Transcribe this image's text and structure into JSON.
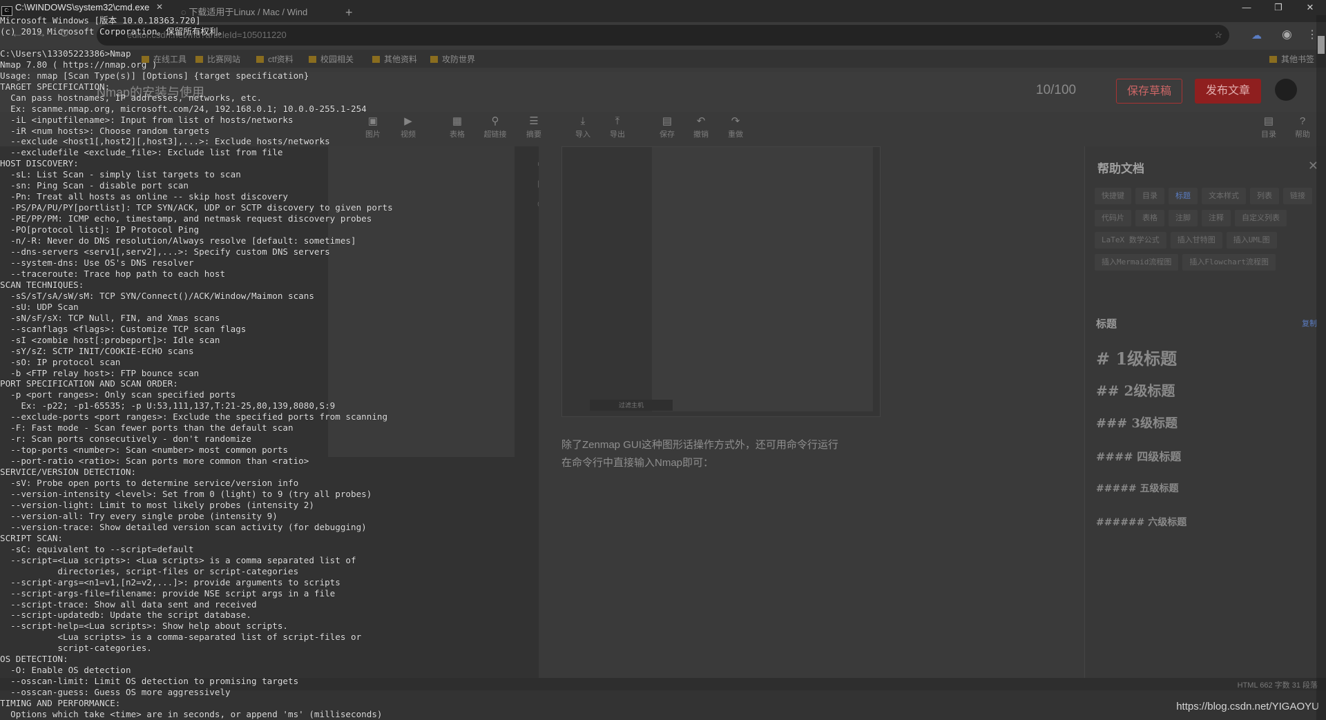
{
  "browser": {
    "tabs": [
      {
        "label": "下载适用于Linux / Mac / Wind"
      }
    ],
    "new_tab": "+",
    "address": "editor.csdn.net/md?articleId=105011220",
    "bookmarks": [
      "在线工具",
      "比赛网站",
      "ctf资料",
      "校园相关",
      "其他资料",
      "攻防世界"
    ],
    "other_bookmarks": "其他书签",
    "article_title": "Nmap的安装与使用",
    "word_count": "10/100",
    "save_draft": "保存草稿",
    "publish": "发布文章",
    "toolbar": [
      {
        "icon": "image-icon",
        "glyph": "▣",
        "label": "图片"
      },
      {
        "icon": "video-icon",
        "glyph": "▶",
        "label": "视频"
      },
      {
        "icon": "table-icon",
        "glyph": "▦",
        "label": "表格"
      },
      {
        "icon": "link-icon",
        "glyph": "⚲",
        "label": "超链接"
      },
      {
        "icon": "summary-icon",
        "glyph": "☰",
        "label": "摘要"
      },
      {
        "icon": "import-icon",
        "glyph": "⤓",
        "label": "导入"
      },
      {
        "icon": "export-icon",
        "glyph": "⤒",
        "label": "导出"
      },
      {
        "icon": "save-icon",
        "glyph": "▤",
        "label": "保存"
      },
      {
        "icon": "undo-icon",
        "glyph": "↶",
        "label": "撤销"
      },
      {
        "icon": "redo-icon",
        "glyph": "↷",
        "label": "重做"
      },
      {
        "icon": "toc-icon",
        "glyph": "▤",
        "label": "目录"
      },
      {
        "icon": "help-icon",
        "glyph": "?",
        "label": "帮助"
      }
    ],
    "image_caption": "过滤主机",
    "preview_text": "除了Zenmap GUI这种图形话操作方式外，还可用命令行运行\n在命令行中直接输入Nmap即可：",
    "help": {
      "title": "帮助文档",
      "chips": [
        "快捷键",
        "目录",
        "标题",
        "文本样式",
        "列表",
        "链接",
        "代码片",
        "表格",
        "注脚",
        "注释",
        "自定义列表",
        "LaTeX 数学公式",
        "插入甘特图",
        "插入UML图",
        "插入Mermaid流程图",
        "插入Flowchart流程图"
      ],
      "section": "标题",
      "copy": "复制",
      "headings": [
        "# 1级标题",
        "## 2级标题",
        "### 3级标题",
        "#### 四级标题",
        "##### 五级标题",
        "###### 六级标题"
      ]
    },
    "status": "HTML 662 字数 31 段落",
    "watermark": "https://blog.csdn.net/YIGAOYU"
  },
  "cmd": {
    "title": "C:\\WINDOWS\\system32\\cmd.exe",
    "controls": {
      "minimize": "—",
      "maximize": "❐",
      "close": "✕"
    },
    "output": [
      "Microsoft Windows [版本 10.0.18363.720]",
      "(c) 2019 Microsoft Corporation。保留所有权利。",
      "",
      "C:\\Users\\13305223386>Nmap",
      "Nmap 7.80 ( https://nmap.org )",
      "Usage: nmap [Scan Type(s)] [Options] {target specification}",
      "TARGET SPECIFICATION:",
      "  Can pass hostnames, IP addresses, networks, etc.",
      "  Ex: scanme.nmap.org, microsoft.com/24, 192.168.0.1; 10.0.0-255.1-254",
      "  -iL <inputfilename>: Input from list of hosts/networks",
      "  -iR <num hosts>: Choose random targets",
      "  --exclude <host1[,host2][,host3],...>: Exclude hosts/networks",
      "  --excludefile <exclude_file>: Exclude list from file",
      "HOST DISCOVERY:",
      "  -sL: List Scan - simply list targets to scan",
      "  -sn: Ping Scan - disable port scan",
      "  -Pn: Treat all hosts as online -- skip host discovery",
      "  -PS/PA/PU/PY[portlist]: TCP SYN/ACK, UDP or SCTP discovery to given ports",
      "  -PE/PP/PM: ICMP echo, timestamp, and netmask request discovery probes",
      "  -PO[protocol list]: IP Protocol Ping",
      "  -n/-R: Never do DNS resolution/Always resolve [default: sometimes]",
      "  --dns-servers <serv1[,serv2],...>: Specify custom DNS servers",
      "  --system-dns: Use OS's DNS resolver",
      "  --traceroute: Trace hop path to each host",
      "SCAN TECHNIQUES:",
      "  -sS/sT/sA/sW/sM: TCP SYN/Connect()/ACK/Window/Maimon scans",
      "  -sU: UDP Scan",
      "  -sN/sF/sX: TCP Null, FIN, and Xmas scans",
      "  --scanflags <flags>: Customize TCP scan flags",
      "  -sI <zombie host[:probeport]>: Idle scan",
      "  -sY/sZ: SCTP INIT/COOKIE-ECHO scans",
      "  -sO: IP protocol scan",
      "  -b <FTP relay host>: FTP bounce scan",
      "PORT SPECIFICATION AND SCAN ORDER:",
      "  -p <port ranges>: Only scan specified ports",
      "    Ex: -p22; -p1-65535; -p U:53,111,137,T:21-25,80,139,8080,S:9",
      "  --exclude-ports <port ranges>: Exclude the specified ports from scanning",
      "  -F: Fast mode - Scan fewer ports than the default scan",
      "  -r: Scan ports consecutively - don't randomize",
      "  --top-ports <number>: Scan <number> most common ports",
      "  --port-ratio <ratio>: Scan ports more common than <ratio>",
      "SERVICE/VERSION DETECTION:",
      "  -sV: Probe open ports to determine service/version info",
      "  --version-intensity <level>: Set from 0 (light) to 9 (try all probes)",
      "  --version-light: Limit to most likely probes (intensity 2)",
      "  --version-all: Try every single probe (intensity 9)",
      "  --version-trace: Show detailed version scan activity (for debugging)",
      "SCRIPT SCAN:",
      "  -sC: equivalent to --script=default",
      "  --script=<Lua scripts>: <Lua scripts> is a comma separated list of",
      "           directories, script-files or script-categories",
      "  --script-args=<n1=v1,[n2=v2,...]>: provide arguments to scripts",
      "  --script-args-file=filename: provide NSE script args in a file",
      "  --script-trace: Show all data sent and received",
      "  --script-updatedb: Update the script database.",
      "  --script-help=<Lua scripts>: Show help about scripts.",
      "           <Lua scripts> is a comma-separated list of script-files or",
      "           script-categories.",
      "OS DETECTION:",
      "  -O: Enable OS detection",
      "  --osscan-limit: Limit OS detection to promising targets",
      "  --osscan-guess: Guess OS more aggressively",
      "TIMING AND PERFORMANCE:",
      "  Options which take <time> are in seconds, or append 'ms' (milliseconds)"
    ]
  }
}
